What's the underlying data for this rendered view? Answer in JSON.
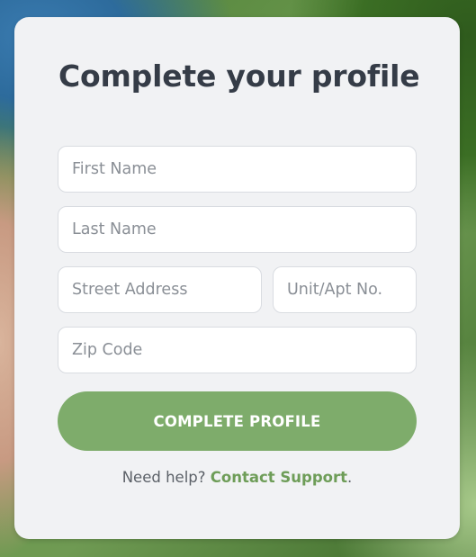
{
  "form": {
    "title": "Complete your profile",
    "fields": {
      "first_name": {
        "value": "",
        "placeholder": "First Name"
      },
      "last_name": {
        "value": "",
        "placeholder": "Last Name"
      },
      "street_address": {
        "value": "",
        "placeholder": "Street Address"
      },
      "unit": {
        "value": "",
        "placeholder": "Unit/Apt No."
      },
      "zip_code": {
        "value": "",
        "placeholder": "Zip Code"
      }
    },
    "submit_label": "COMPLETE PROFILE",
    "help": {
      "prefix": "Need help?",
      "link_label": "Contact Support",
      "suffix": "."
    }
  },
  "colors": {
    "card_background": "#f1f2f4",
    "title_text": "#353c47",
    "button_background": "#7eac6b",
    "link_text": "#6e9d58"
  }
}
